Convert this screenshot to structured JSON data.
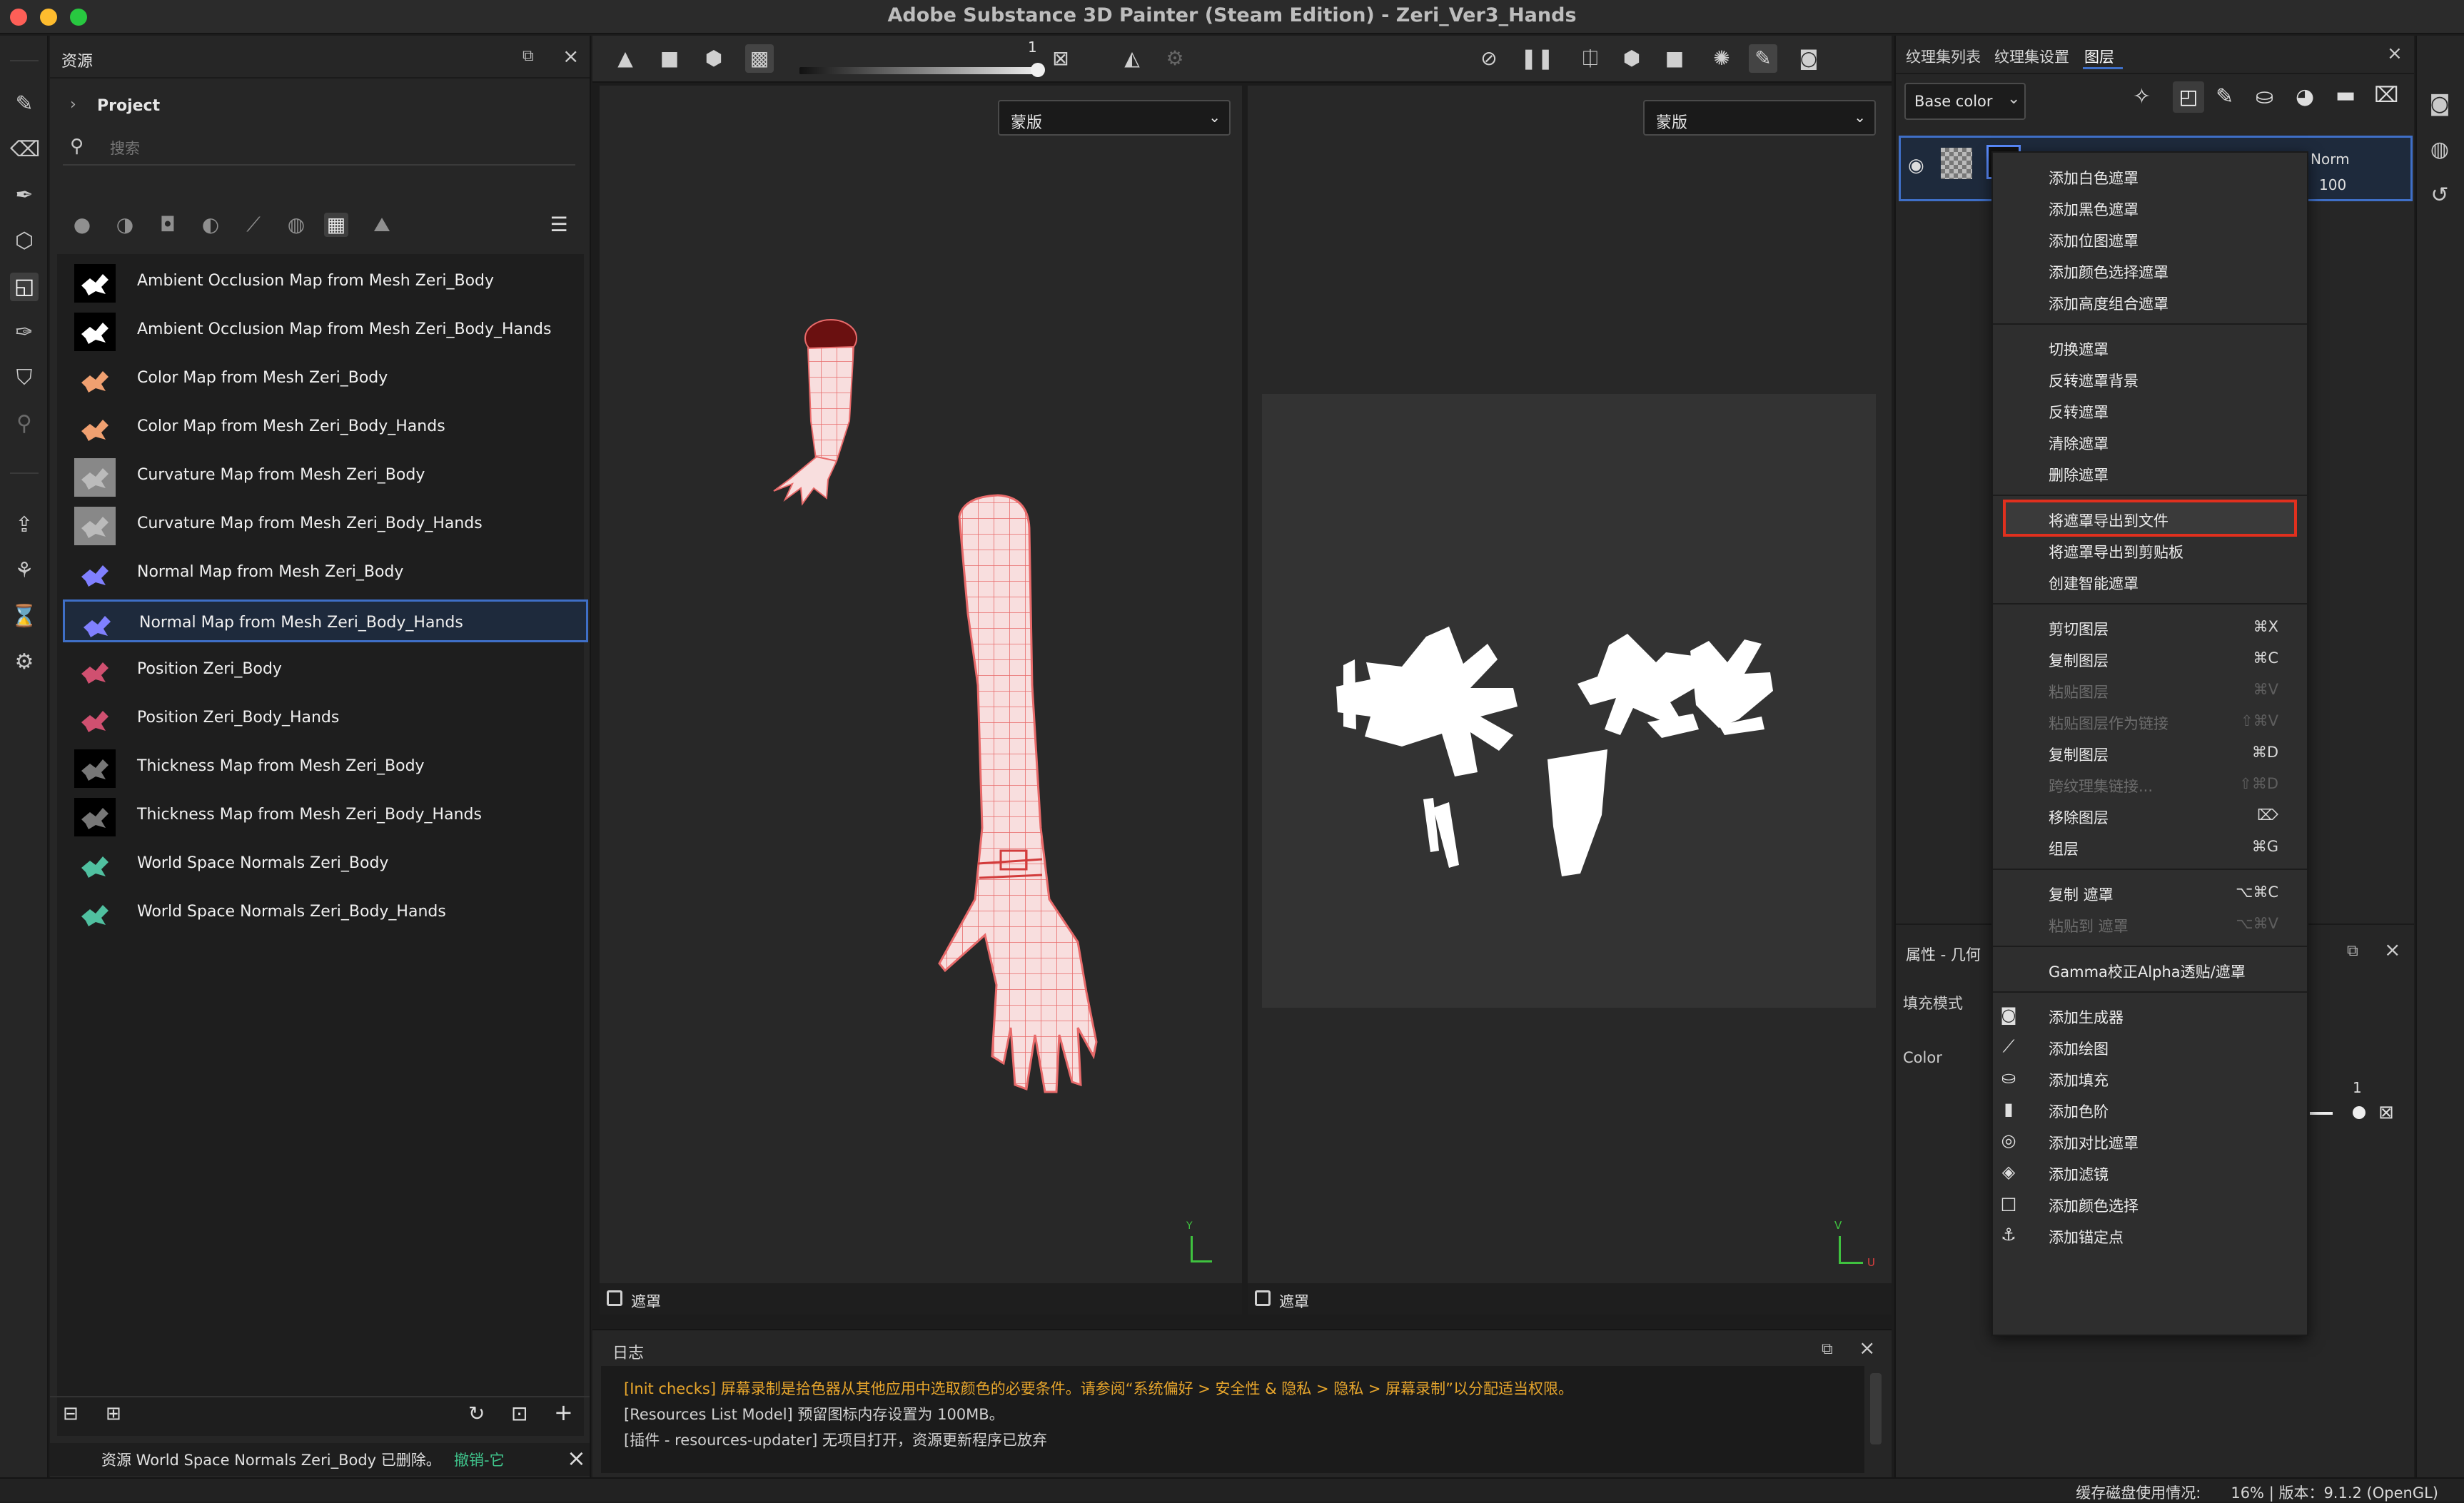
{
  "window": {
    "title": "Adobe Substance 3D Painter (Steam Edition) - Zeri_Ver3_Hands"
  },
  "assets": {
    "panel_title": "资源",
    "project_label": "Project",
    "search_placeholder": "搜索",
    "items": [
      {
        "name": "Ambient Occlusion Map from Mesh Zeri_Body",
        "thumb": "ao"
      },
      {
        "name": "Ambient Occlusion Map from Mesh Zeri_Body_Hands",
        "thumb": "ao"
      },
      {
        "name": "Color Map from Mesh Zeri_Body",
        "thumb": "color"
      },
      {
        "name": "Color Map from Mesh Zeri_Body_Hands",
        "thumb": "color"
      },
      {
        "name": "Curvature Map from Mesh Zeri_Body",
        "thumb": "curv"
      },
      {
        "name": "Curvature Map from Mesh Zeri_Body_Hands",
        "thumb": "curv"
      },
      {
        "name": "Normal Map from Mesh Zeri_Body",
        "thumb": "normal"
      },
      {
        "name": "Normal Map from Mesh Zeri_Body_Hands",
        "thumb": "normal",
        "selected": true
      },
      {
        "name": "Position Zeri_Body",
        "thumb": "pos"
      },
      {
        "name": "Position Zeri_Body_Hands",
        "thumb": "pos"
      },
      {
        "name": "Thickness Map from Mesh Zeri_Body",
        "thumb": "thick"
      },
      {
        "name": "Thickness Map from Mesh Zeri_Body_Hands",
        "thumb": "thick"
      },
      {
        "name": "World Space Normals Zeri_Body",
        "thumb": "wsn"
      },
      {
        "name": "World Space Normals Zeri_Body_Hands",
        "thumb": "wsn"
      }
    ],
    "status_text": "资源 World Space Normals Zeri_Body 已删除。",
    "undo_text": "撤销-它"
  },
  "viewport": {
    "slider_value": "1",
    "left_dropdown": "蒙版",
    "right_dropdown": "蒙版",
    "left_footer": "遮罩",
    "right_footer": "遮罩",
    "axis_v": "V",
    "axis_u": "U"
  },
  "log": {
    "title": "日志",
    "lines": [
      {
        "text": "[Init checks] 屏幕录制是拾色器从其他应用中选取颜色的必要条件。请参阅“系统偏好 > 安全性 & 隐私 > 隐私 > 屏幕录制”以分配适当权限。",
        "color": "#e8a62c"
      },
      {
        "text": "[Resources List Model] 预留图标内存设置为 100MB。",
        "color": "#d0d0d0"
      },
      {
        "text": "[插件 - resources-updater] 无项目打开，资源更新程序已放弃",
        "color": "#d0d0d0"
      }
    ]
  },
  "right_panel": {
    "tabs": [
      "纹理集列表",
      "纹理集设置",
      "图层"
    ],
    "channel": "Base color",
    "blend_mode": "Norm",
    "opacity": "100",
    "props_title": "属性 - 几何",
    "fill_mode_label": "填充模式",
    "color_label": "Color",
    "color_value": "1"
  },
  "context_menu": {
    "groups": [
      [
        {
          "label": "添加白色遮罩"
        },
        {
          "label": "添加黑色遮罩"
        },
        {
          "label": "添加位图遮罩"
        },
        {
          "label": "添加颜色选择遮罩"
        },
        {
          "label": "添加高度组合遮罩"
        }
      ],
      [
        {
          "label": "切换遮罩"
        },
        {
          "label": "反转遮罩背景"
        },
        {
          "label": "反转遮罩"
        },
        {
          "label": "清除遮罩"
        },
        {
          "label": "删除遮罩"
        }
      ],
      [
        {
          "label": "将遮罩导出到文件",
          "highlight": true
        },
        {
          "label": "将遮罩导出到剪贴板"
        },
        {
          "label": "创建智能遮罩"
        }
      ],
      [
        {
          "label": "剪切图层",
          "shortcut": "⌘X"
        },
        {
          "label": "复制图层",
          "shortcut": "⌘C"
        },
        {
          "label": "粘贴图层",
          "shortcut": "⌘V",
          "disabled": true
        },
        {
          "label": "粘贴图层作为链接",
          "shortcut": "⇧⌘V",
          "disabled": true
        },
        {
          "label": "复制图层",
          "shortcut": "⌘D"
        },
        {
          "label": "跨纹理集链接...",
          "shortcut": "⇧⌘D",
          "disabled": true
        },
        {
          "label": "移除图层",
          "shortcut": "⌦"
        },
        {
          "label": "组层",
          "shortcut": "⌘G"
        }
      ],
      [
        {
          "label": "复制 遮罩",
          "shortcut": "⌥⌘C"
        },
        {
          "label": "粘贴到 遮罩",
          "shortcut": "⌥⌘V",
          "disabled": true
        }
      ],
      [
        {
          "label": "Gamma校正Alpha透贴/遮罩"
        }
      ],
      [
        {
          "label": "添加生成器",
          "icon": "generator-icon"
        },
        {
          "label": "添加绘图",
          "icon": "brush-icon"
        },
        {
          "label": "添加填充",
          "icon": "fill-bucket-icon"
        },
        {
          "label": "添加色阶",
          "icon": "levels-icon"
        },
        {
          "label": "添加对比遮罩",
          "icon": "compare-mask-icon"
        },
        {
          "label": "添加滤镜",
          "icon": "filter-icon"
        },
        {
          "label": "添加颜色选择",
          "icon": "color-selection-icon"
        },
        {
          "label": "添加锚定点",
          "icon": "anchor-icon"
        }
      ]
    ]
  },
  "status_bar": {
    "text": "缓存磁盘使用情况:　　16% | 版本：9.1.2 (OpenGL)"
  },
  "colors": {
    "accent": "#3f6fc7",
    "highlight_border": "#e0301e",
    "log_warning": "#e8a62c",
    "undo_link": "#3fc28a"
  }
}
